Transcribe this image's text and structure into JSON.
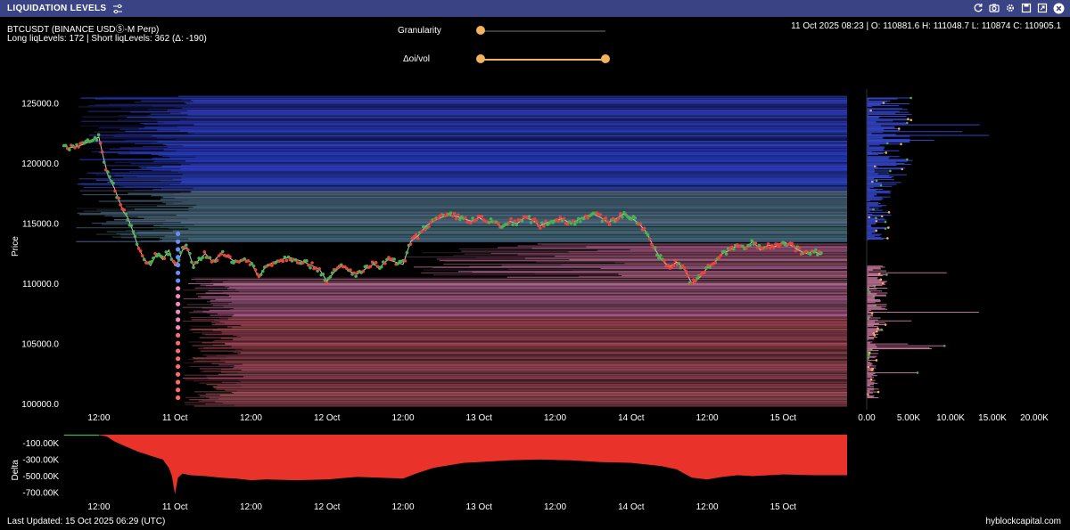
{
  "window": {
    "title": "LIQUIDATION LEVELS",
    "toolbar_icons": [
      "refresh-icon",
      "camera-icon",
      "gear-icon",
      "save-icon",
      "expand-icon",
      "close-icon"
    ]
  },
  "header": {
    "symbol": "BTCUSDT (BINANCE USDⓈ-M Perp)",
    "levels": "Long liqLevels: 172 | Short liqLevels: 362 (Δ: -190)",
    "ohlc": "11 Oct 2025 08:23 | O: 110881.6 H: 111048.7 L: 110874 C: 110905.1"
  },
  "controls": {
    "granularity": {
      "label": "Granularity",
      "value": 0.0
    },
    "doi_vol": {
      "label": "Δoi/vol",
      "range": [
        0.0,
        1.0
      ]
    }
  },
  "footer": {
    "last_updated": "Last Updated: 15 Oct 2025 06:29 (UTC)",
    "brand": "hyblockcapital.com"
  },
  "colors": {
    "titlebar": "#3a4384",
    "accent": "#f3b35c",
    "short_levels": "#2a3bd6",
    "long_levels": "#e58ab4",
    "price_up": "#4caf50",
    "price_down": "#e8453c",
    "delta": "#e8322a"
  },
  "chart_data": [
    {
      "type": "line",
      "name": "price",
      "ylabel": "Price",
      "ylim": [
        99500,
        126200
      ],
      "y_ticks": [
        "125000.0",
        "120000.0",
        "115000.0",
        "110000.0",
        "105000.0",
        "100000.0"
      ],
      "x_ticks": [
        "12:00",
        "11 Oct",
        "12:00",
        "12 Oct",
        "12:00",
        "13 Oct",
        "12:00",
        "14 Oct",
        "12:00",
        "15 Oct"
      ],
      "x_tick_values": [
        0.5,
        1.0,
        1.5,
        2.0,
        2.5,
        3.0,
        3.5,
        4.0,
        4.5,
        5.0
      ],
      "xlim": [
        0.26,
        5.42
      ],
      "x": [
        0.27,
        0.3,
        0.35,
        0.4,
        0.45,
        0.5,
        0.53,
        0.56,
        0.6,
        0.63,
        0.66,
        0.69,
        0.72,
        0.76,
        0.8,
        0.84,
        0.88,
        0.92,
        0.96,
        0.98,
        1.0,
        1.02,
        1.05,
        1.08,
        1.12,
        1.16,
        1.2,
        1.25,
        1.3,
        1.35,
        1.4,
        1.45,
        1.5,
        1.55,
        1.6,
        1.65,
        1.7,
        1.75,
        1.8,
        1.85,
        1.9,
        1.95,
        2.0,
        2.05,
        2.1,
        2.15,
        2.2,
        2.25,
        2.3,
        2.35,
        2.4,
        2.45,
        2.5,
        2.55,
        2.6,
        2.65,
        2.7,
        2.75,
        2.8,
        2.85,
        2.9,
        2.95,
        3.0,
        3.05,
        3.1,
        3.15,
        3.2,
        3.25,
        3.3,
        3.35,
        3.4,
        3.45,
        3.5,
        3.55,
        3.6,
        3.65,
        3.7,
        3.75,
        3.8,
        3.85,
        3.9,
        3.95,
        4.0,
        4.05,
        4.1,
        4.15,
        4.2,
        4.25,
        4.3,
        4.35,
        4.4,
        4.45,
        4.5,
        4.55,
        4.6,
        4.65,
        4.7,
        4.75,
        4.8,
        4.85,
        4.9,
        4.95,
        5.0,
        5.05,
        5.1,
        5.15,
        5.2,
        5.25
      ],
      "values": [
        121600,
        121300,
        121400,
        121600,
        121900,
        122200,
        120500,
        119000,
        118000,
        117000,
        116000,
        115500,
        114500,
        113000,
        112000,
        111500,
        112500,
        112000,
        112800,
        112000,
        111500,
        111800,
        112800,
        113000,
        111500,
        112000,
        112500,
        111800,
        112500,
        112200,
        111800,
        112000,
        111800,
        110500,
        111500,
        111800,
        112000,
        112200,
        112000,
        111800,
        111500,
        111200,
        110200,
        111000,
        111500,
        111000,
        110800,
        111200,
        111600,
        111400,
        112000,
        111800,
        111600,
        113500,
        114000,
        114800,
        115200,
        115500,
        115700,
        115600,
        115400,
        115200,
        115500,
        115100,
        115200,
        114700,
        115200,
        115000,
        115500,
        115300,
        114800,
        115100,
        115300,
        115400,
        115000,
        115300,
        115600,
        115800,
        115500,
        115100,
        115400,
        115800,
        115500,
        115000,
        114300,
        113000,
        112000,
        111400,
        111800,
        111200,
        110000,
        110500,
        111300,
        111800,
        112500,
        112800,
        113200,
        113000,
        113500,
        112800,
        113200,
        113100,
        113500,
        113200,
        112800,
        112500,
        112700,
        112400
      ]
    },
    {
      "type": "bar",
      "name": "liquidation-volume-profile",
      "x_ticks": [
        "0.00",
        "5.00K",
        "10.00K",
        "15.00K",
        "20.00K"
      ]
    },
    {
      "type": "area",
      "name": "delta",
      "ylabel": "Delta",
      "ylim": [
        -850000,
        0
      ],
      "y_ticks": [
        "-100.00K",
        "-300.00K",
        "-500.00K",
        "-700.00K"
      ],
      "x_ticks": [
        "12:00",
        "11 Oct",
        "12:00",
        "12 Oct",
        "12:00",
        "13 Oct",
        "12:00",
        "14 Oct",
        "12:00",
        "15 Oct"
      ],
      "x": [
        0.27,
        0.5,
        0.55,
        0.6,
        0.65,
        0.7,
        0.75,
        0.8,
        0.85,
        0.92,
        0.96,
        0.98,
        1.0,
        1.02,
        1.05,
        1.1,
        1.2,
        1.3,
        1.4,
        1.5,
        1.6,
        1.8,
        2.0,
        2.2,
        2.5,
        2.6,
        2.7,
        2.8,
        2.9,
        3.0,
        3.2,
        3.4,
        3.6,
        3.8,
        4.0,
        4.2,
        4.3,
        4.35,
        4.4,
        4.5,
        4.6,
        4.7,
        4.8,
        5.0,
        5.2,
        5.25
      ],
      "values": [
        -5000,
        -5000,
        -20000,
        -80000,
        -120000,
        -160000,
        -200000,
        -230000,
        -260000,
        -300000,
        -400000,
        -500000,
        -720000,
        -520000,
        -470000,
        -490000,
        -500000,
        -520000,
        -530000,
        -550000,
        -540000,
        -550000,
        -540000,
        -510000,
        -530000,
        -460000,
        -400000,
        -370000,
        -340000,
        -330000,
        -310000,
        -300000,
        -310000,
        -330000,
        -340000,
        -380000,
        -420000,
        -470000,
        -520000,
        -540000,
        -510000,
        -490000,
        -500000,
        -480000,
        -490000,
        -490000
      ]
    }
  ]
}
